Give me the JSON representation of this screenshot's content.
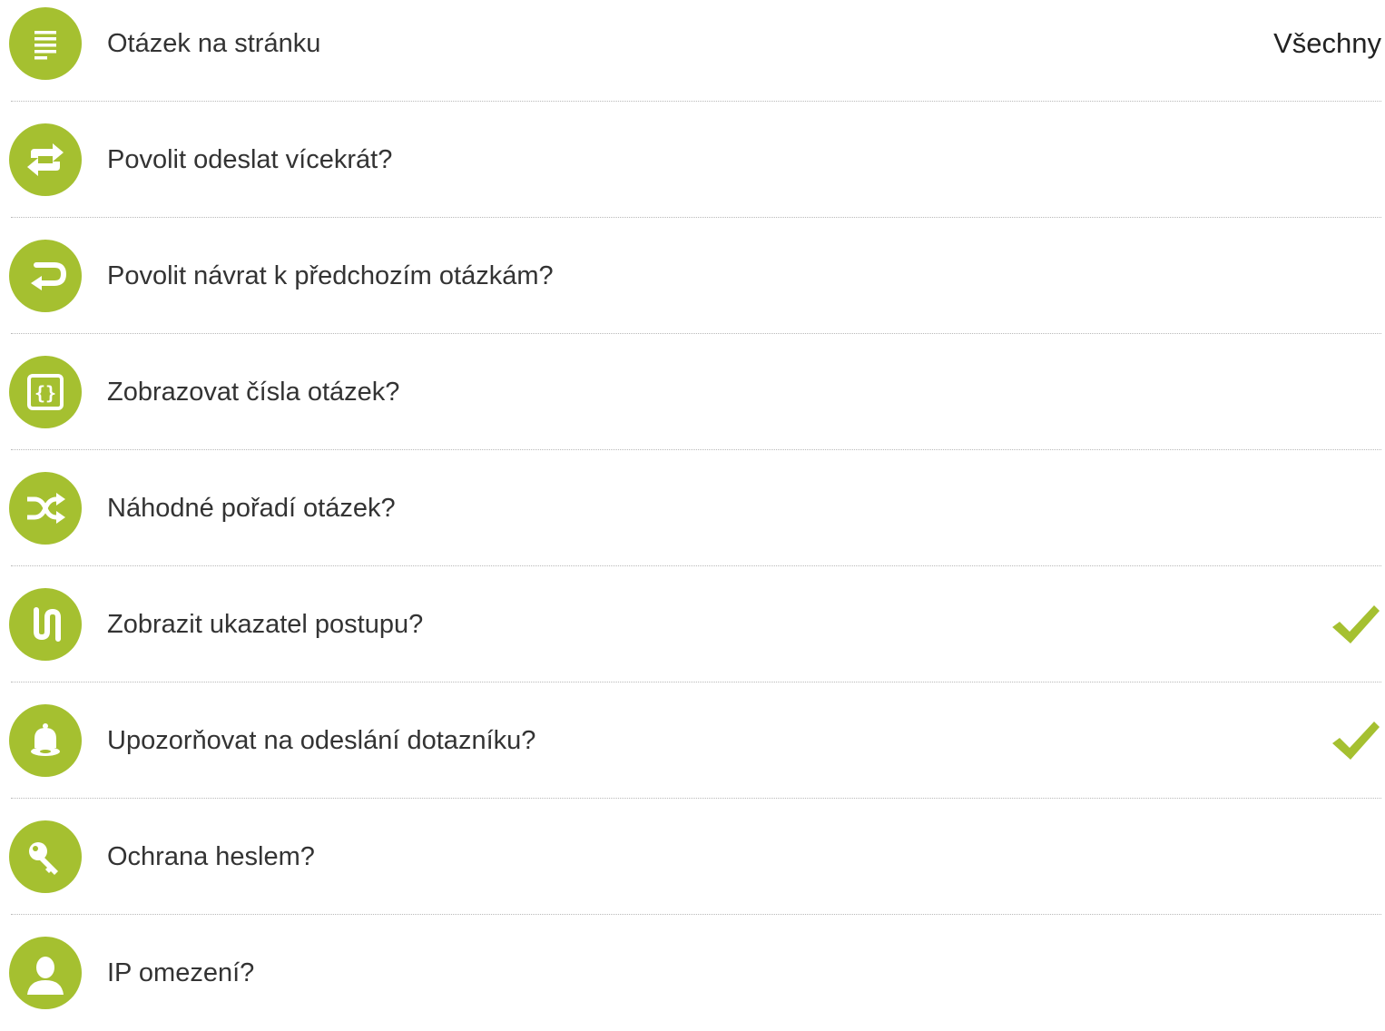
{
  "theme": {
    "accent": "#a5c030",
    "text": "#333333",
    "divider": "#b9b9b9"
  },
  "settings": [
    {
      "label": "Otázek na stránku",
      "icon": "list-icon",
      "value": "Všechny",
      "checked": false
    },
    {
      "label": "Povolit odeslat vícekrát?",
      "icon": "repeat-icon",
      "value": "",
      "checked": false
    },
    {
      "label": "Povolit návrat k předchozím otázkám?",
      "icon": "return-arrow-icon",
      "value": "",
      "checked": false
    },
    {
      "label": "Zobrazovat čísla otázek?",
      "icon": "braces-icon",
      "value": "",
      "checked": false
    },
    {
      "label": "Náhodné pořadí otázek?",
      "icon": "shuffle-icon",
      "value": "",
      "checked": false
    },
    {
      "label": "Zobrazit ukazatel postupu?",
      "icon": "progress-path-icon",
      "value": "",
      "checked": true
    },
    {
      "label": "Upozorňovat na odeslání dotazníku?",
      "icon": "bell-icon",
      "value": "",
      "checked": true
    },
    {
      "label": "Ochrana heslem?",
      "icon": "key-icon",
      "value": "",
      "checked": false
    },
    {
      "label": "IP omezení?",
      "icon": "user-icon",
      "value": "",
      "checked": false
    }
  ]
}
